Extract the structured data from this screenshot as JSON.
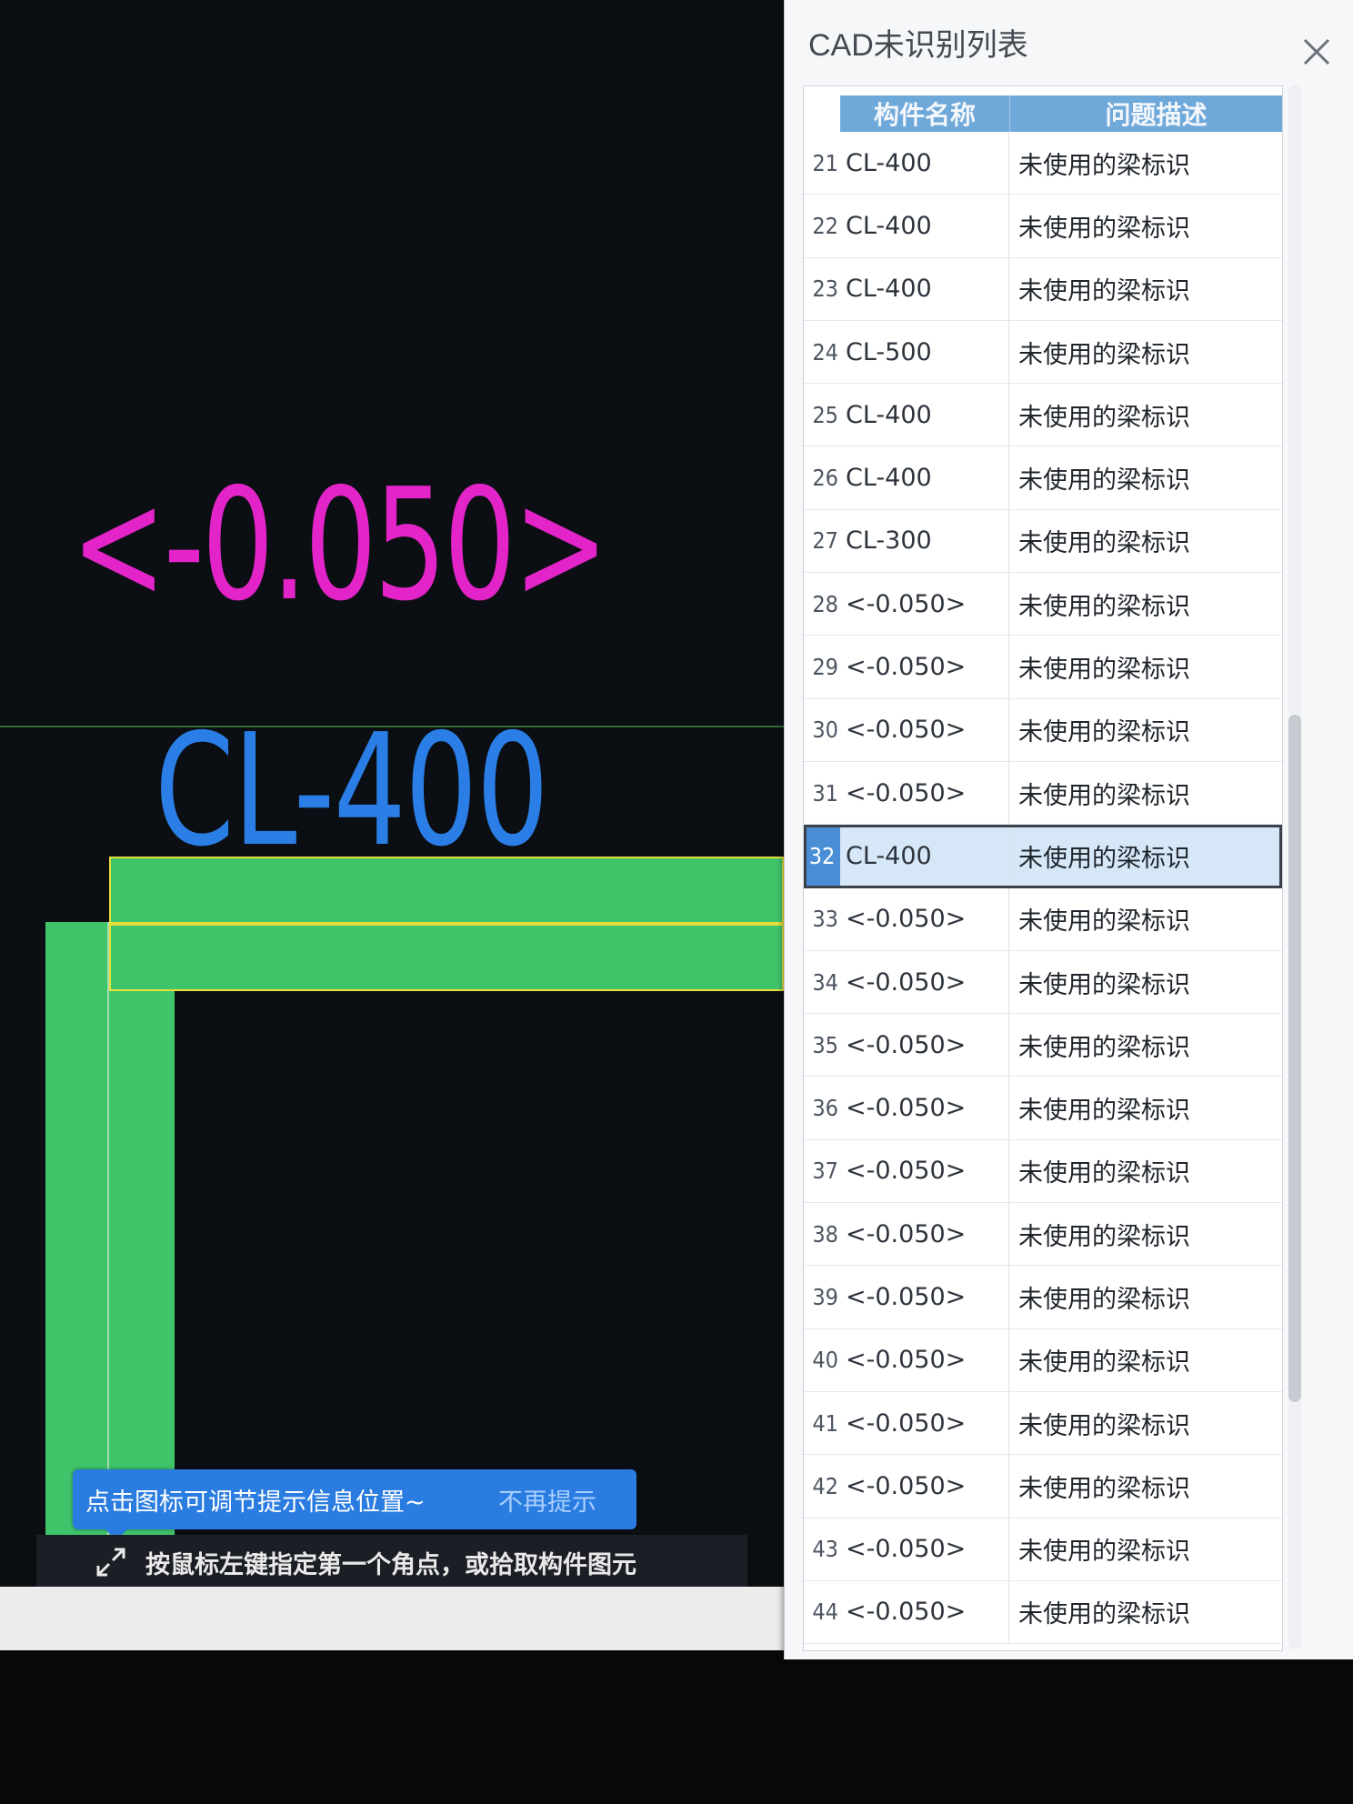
{
  "canvas": {
    "elevation_label": "<-0.050>",
    "beam_label": "CL-400"
  },
  "tooltip": {
    "text": "点击图标可调节提示信息位置~",
    "dismiss": "不再提示"
  },
  "status_bar": {
    "text": "按鼠标左键指定第一个角点，或拾取构件图元",
    "icon": "resize-arrows-icon"
  },
  "dialog": {
    "title": "CAD未识别列表",
    "close_icon": "close-icon",
    "columns": [
      "构件名称",
      "问题描述"
    ],
    "selected_row": 32,
    "rows": [
      {
        "no": "21",
        "name": "CL-400",
        "desc": "未使用的梁标识"
      },
      {
        "no": "22",
        "name": "CL-400",
        "desc": "未使用的梁标识"
      },
      {
        "no": "23",
        "name": "CL-400",
        "desc": "未使用的梁标识"
      },
      {
        "no": "24",
        "name": "CL-500",
        "desc": "未使用的梁标识"
      },
      {
        "no": "25",
        "name": "CL-400",
        "desc": "未使用的梁标识"
      },
      {
        "no": "26",
        "name": "CL-400",
        "desc": "未使用的梁标识"
      },
      {
        "no": "27",
        "name": "CL-300",
        "desc": "未使用的梁标识"
      },
      {
        "no": "28",
        "name": "<-0.050>",
        "desc": "未使用的梁标识"
      },
      {
        "no": "29",
        "name": "<-0.050>",
        "desc": "未使用的梁标识"
      },
      {
        "no": "30",
        "name": "<-0.050>",
        "desc": "未使用的梁标识"
      },
      {
        "no": "31",
        "name": "<-0.050>",
        "desc": "未使用的梁标识"
      },
      {
        "no": "32",
        "name": "CL-400",
        "desc": "未使用的梁标识"
      },
      {
        "no": "33",
        "name": "<-0.050>",
        "desc": "未使用的梁标识"
      },
      {
        "no": "34",
        "name": "<-0.050>",
        "desc": "未使用的梁标识"
      },
      {
        "no": "35",
        "name": "<-0.050>",
        "desc": "未使用的梁标识"
      },
      {
        "no": "36",
        "name": "<-0.050>",
        "desc": "未使用的梁标识"
      },
      {
        "no": "37",
        "name": "<-0.050>",
        "desc": "未使用的梁标识"
      },
      {
        "no": "38",
        "name": "<-0.050>",
        "desc": "未使用的梁标识"
      },
      {
        "no": "39",
        "name": "<-0.050>",
        "desc": "未使用的梁标识"
      },
      {
        "no": "40",
        "name": "<-0.050>",
        "desc": "未使用的梁标识"
      },
      {
        "no": "41",
        "name": "<-0.050>",
        "desc": "未使用的梁标识"
      },
      {
        "no": "42",
        "name": "<-0.050>",
        "desc": "未使用的梁标识"
      },
      {
        "no": "43",
        "name": "<-0.050>",
        "desc": "未使用的梁标识"
      },
      {
        "no": "44",
        "name": "<-0.050>",
        "desc": "未使用的梁标识"
      }
    ]
  },
  "colors": {
    "elevation_text": "#e324c8",
    "beam_text": "#2a7ee6",
    "beam_fill": "#3fc46a",
    "beam_outline": "#e8e03a",
    "header_bg": "#6fa9da",
    "tooltip_bg": "#2a7ce0"
  }
}
